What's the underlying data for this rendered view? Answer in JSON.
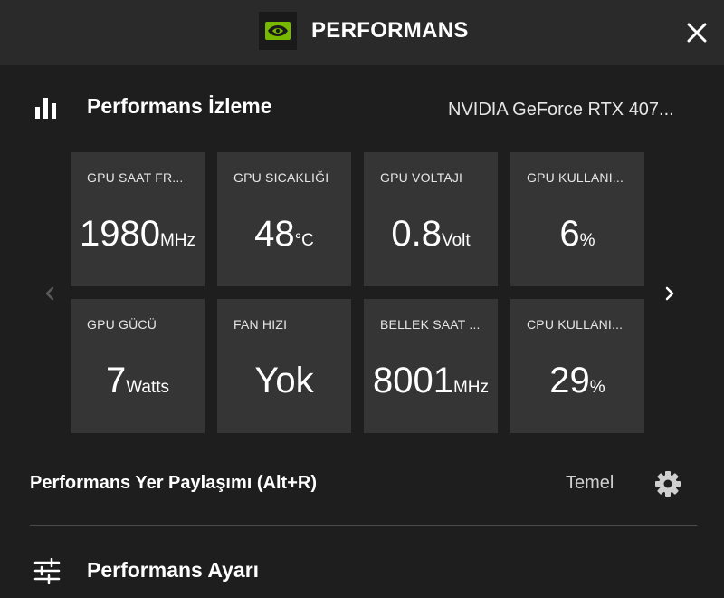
{
  "header": {
    "title": "PERFORMANS",
    "logo_icon": "nvidia-logo-icon",
    "close_icon": "close-icon",
    "accent_color": "#76b900"
  },
  "monitor": {
    "title": "Performans İzleme",
    "icon": "bar-chart-icon",
    "gpu_name": "NVIDIA GeForce RTX 407..."
  },
  "tiles": [
    {
      "label": "GPU SAAT FR...",
      "value": "1980",
      "unit": "MHz"
    },
    {
      "label": "GPU SICAKLIĞI",
      "value": "48",
      "unit": "°C"
    },
    {
      "label": "GPU VOLTAJI",
      "value": "0.8",
      "unit": "Volt"
    },
    {
      "label": "GPU KULLANI...",
      "value": "6",
      "unit": "%"
    },
    {
      "label": "GPU GÜCÜ",
      "value": "7",
      "unit": "Watts"
    },
    {
      "label": "FAN HIZI",
      "value": "Yok",
      "unit": ""
    },
    {
      "label": "BELLEK SAAT ...",
      "value": "8001",
      "unit": "MHz"
    },
    {
      "label": "CPU KULLANI...",
      "value": "29",
      "unit": "%"
    }
  ],
  "nav": {
    "prev_icon": "chevron-left-icon",
    "next_icon": "chevron-right-icon"
  },
  "overlay": {
    "label": "Performans Yer Paylaşımı (Alt+R)",
    "value": "Temel",
    "icon": "gear-icon"
  },
  "tuning": {
    "label": "Performans Ayarı",
    "icon": "sliders-icon"
  }
}
